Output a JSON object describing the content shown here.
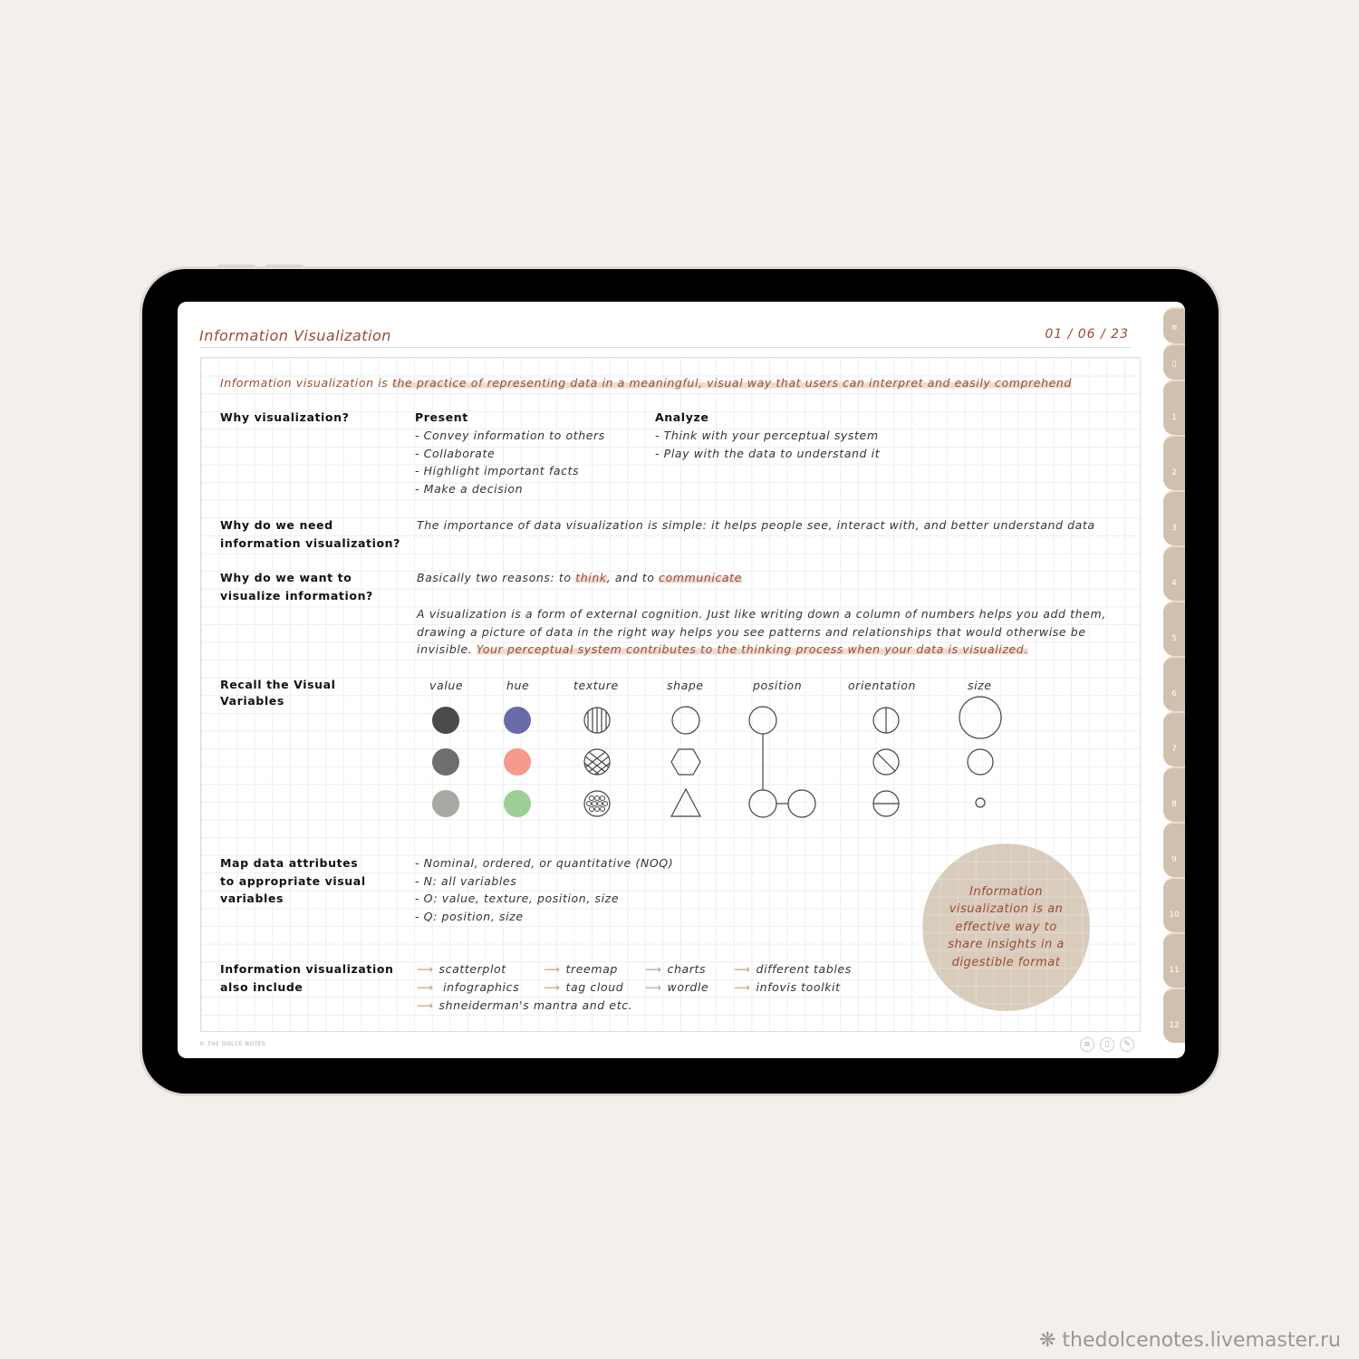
{
  "page": {
    "title": "Information Visualization",
    "date": "01 / 06 / 23",
    "footer": "© THE DOLCE NOTES"
  },
  "intro": {
    "pre": "Information visualization is ",
    "highlight": "the practice of representing data in a meaningful, visual way that users can interpret and easily comprehend"
  },
  "why": {
    "label": "Why visualization?",
    "present_title": "Present",
    "present": [
      "- Convey information to others",
      "- Collaborate",
      "- Highlight important facts",
      "- Make a decision"
    ],
    "analyze_title": "Analyze",
    "analyze": [
      "- Think with your perceptual system",
      "- Play with the data to understand it"
    ]
  },
  "need": {
    "label1": "Why do we need",
    "label2": "information visualization?",
    "text": "The importance of data visualization is simple: it helps people see, interact with, and better understand data"
  },
  "want": {
    "label1": "Why do we want to",
    "label2": "visualize information?",
    "r1": "Basically two reasons: to ",
    "think": "think",
    "r2": ", and to ",
    "communicate": "communicate",
    "p1": "A visualization is a form of external cognition. Just like writing down a column of numbers helps you add them,",
    "p2": "drawing a picture of data in the right way helps you see patterns and relationships that would otherwise be",
    "p3": "invisible. ",
    "p3hl": "Your perceptual system contributes to the thinking process when your data is visualized."
  },
  "variables": {
    "label1": "Recall the Visual",
    "label2": "Variables",
    "headers": [
      "value",
      "hue",
      "texture",
      "shape",
      "position",
      "orientation",
      "size"
    ],
    "value_colors": [
      "#4a4a4a",
      "#6e6e6e",
      "#a9a8a3"
    ],
    "hue_colors": [
      "#6a6aa8",
      "#f59a8c",
      "#9dcf94"
    ]
  },
  "map": {
    "label1": "Map data attributes",
    "label2": "to appropriate visual",
    "label3": "variables",
    "items": [
      "- Nominal, ordered, or quantitative (NOQ)",
      "- N: all variables",
      "- O: value, texture, position, size",
      "- Q: position, size"
    ]
  },
  "include": {
    "label1": "Information visualization",
    "label2": "also include",
    "items": [
      "scatterplot",
      "treemap",
      "charts",
      "different tables",
      "infographics",
      "tag cloud",
      "wordle",
      "infovis toolkit",
      "shneiderman's mantra and etc."
    ]
  },
  "callout": "Information visualization is an effective way to share insights in a digestible format",
  "tabs": [
    "1",
    "2",
    "3",
    "4",
    "5",
    "6",
    "7",
    "8",
    "9",
    "10",
    "11",
    "12"
  ],
  "watermark": "thedolcenotes.livemaster.ru",
  "colors": {
    "accent": "#9a4c36",
    "tab": "#cfc0b0",
    "highlight": "#ecdcd0"
  }
}
